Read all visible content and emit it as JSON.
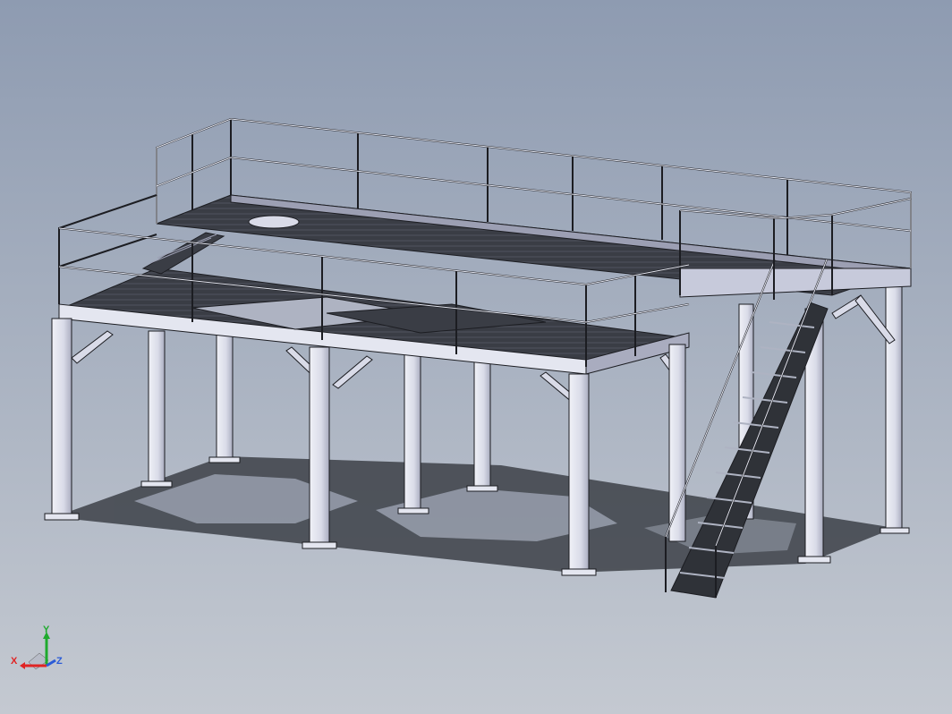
{
  "viewport": {
    "background_top": "#8e9bb1",
    "background_bottom": "#c4c9d1"
  },
  "model": {
    "steel_light": "#e4e6f0",
    "steel_mid": "#c7cadb",
    "steel_dark": "#9c9fb3",
    "deck_grating": "#3a3d45",
    "deck_grating_light": "#5a5e68",
    "edge_line": "#1c1d22",
    "shadow": "#3d4148"
  },
  "triad": {
    "x_label": "X",
    "y_label": "Y",
    "z_label": "Z",
    "x_color": "#e02424",
    "y_color": "#1faa2e",
    "z_color": "#2a5bd7"
  }
}
